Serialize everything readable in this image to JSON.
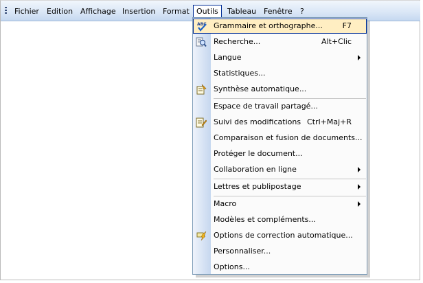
{
  "menubar": {
    "items": [
      "Fichier",
      "Edition",
      "Affichage",
      "Insertion",
      "Format",
      "Outils",
      "Tableau",
      "Fenêtre",
      "?"
    ]
  },
  "menu": {
    "title": "Outils",
    "items": [
      {
        "label": "Grammaire et orthographe...",
        "shortcut": "F7",
        "icon": "spelling-check-icon",
        "highlighted": true
      },
      {
        "label": "Recherche...",
        "shortcut": "Alt+Clic",
        "icon": "research-icon"
      },
      {
        "label": "Langue",
        "submenu": true
      },
      {
        "label": "Statistiques..."
      },
      {
        "label": "Synthèse automatique...",
        "icon": "autosummarize-icon"
      },
      {
        "label": "Espace de travail partagé..."
      },
      {
        "label": "Suivi des modifications",
        "shortcut": "Ctrl+Maj+R",
        "icon": "track-changes-icon"
      },
      {
        "label": "Comparaison et fusion de documents..."
      },
      {
        "label": "Protéger le document..."
      },
      {
        "label": "Collaboration en ligne",
        "submenu": true
      },
      {
        "label": "Lettres et publipostage",
        "submenu": true
      },
      {
        "label": "Macro",
        "submenu": true
      },
      {
        "label": "Modèles et compléments..."
      },
      {
        "label": "Options de correction automatique...",
        "icon": "autocorrect-icon"
      },
      {
        "label": "Personnaliser..."
      },
      {
        "label": "Options..."
      }
    ]
  },
  "colors": {
    "highlight_fill": "#ffeec2",
    "highlight_border": "#002d96",
    "menubar_gradient_top": "#f1f6fc",
    "menubar_gradient_bottom": "#c5d8f0"
  }
}
